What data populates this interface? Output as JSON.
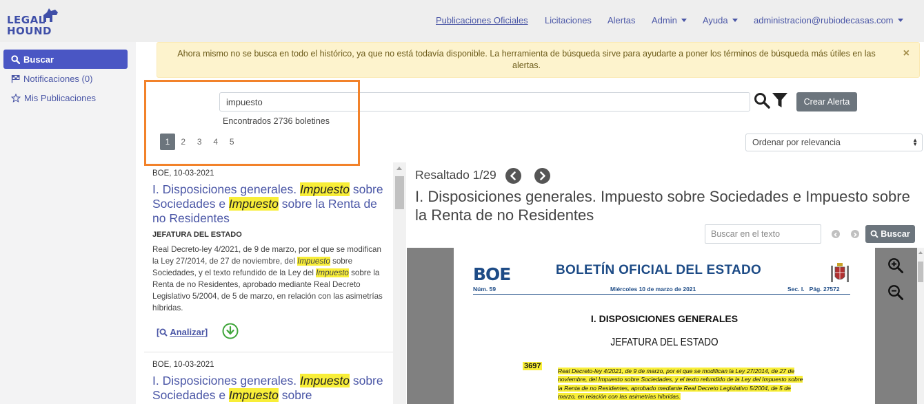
{
  "brand": {
    "line1": "LEGAL",
    "line2": "HOUND",
    "color": "#3f4fa8"
  },
  "nav": {
    "publicaciones": "Publicaciones Oficiales",
    "licitaciones": "Licitaciones",
    "alertas": "Alertas",
    "admin": "Admin",
    "ayuda": "Ayuda",
    "user": "administracion@rubiodecasas.com"
  },
  "sidebar": {
    "items": [
      {
        "label": "Buscar",
        "icon": "search-icon",
        "active": true
      },
      {
        "label": "Notificaciones (0)",
        "icon": "flag-icon"
      },
      {
        "label": "Mis Publicaciones",
        "icon": "star-icon"
      }
    ]
  },
  "alert": {
    "text": "Ahora mismo no se busca en todo el histórico, ya que no está todavía disponible. La herramienta de búsqueda sirve para ayudarte a poner los términos de búsqueda más útiles en las alertas.",
    "close": "×"
  },
  "search": {
    "query": "impuesto",
    "found": "Encontrados 2736 boletines",
    "create_alert": "Crear Alerta",
    "pages": [
      "1",
      "2",
      "3",
      "4",
      "5"
    ],
    "sort": "Ordenar por relevancia"
  },
  "results": [
    {
      "source": "BOE, 10-03-2021",
      "title_parts": [
        "I. Disposiciones generales. ",
        "Impuesto",
        " sobre Sociedades e ",
        "Impuesto",
        " sobre la Renta de no Residentes"
      ],
      "department": "JEFATURA DEL ESTADO",
      "body_parts": [
        "Real Decreto-ley 4/2021, de 9 de marzo, por el que se modifican la Ley 27/2014, de 27 de noviembre, del ",
        "Impuesto",
        " sobre Sociedades, y el texto refundido de la Ley del ",
        "Impuesto",
        " sobre la Renta de no Residentes, aprobado mediante Real Decreto Legislativo 5/2004, de 5 de marzo, en relación con las asimetrías híbridas."
      ],
      "analyze": "Analizar"
    },
    {
      "source": "BOE, 10-03-2021",
      "title_parts": [
        "I. Disposiciones generales. ",
        "Impuesto",
        " sobre Sociedades e ",
        "Impuesto",
        " sobre"
      ]
    }
  ],
  "viewer": {
    "resaltado": "Resaltado 1/29",
    "title": "I. Disposiciones generales. Impuesto sobre Sociedades e Impuesto sobre la Renta de no Residentes",
    "text_search_placeholder": "Buscar en el texto",
    "search_button": "Buscar"
  },
  "pdf": {
    "logo": "BOE",
    "header": "BOLETÍN OFICIAL DEL ESTADO",
    "num": "Núm. 59",
    "date": "Miércoles 10 de marzo de 2021",
    "sec": "Sec. I.   Pág. 27572",
    "section": "I. DISPOSICIONES GENERALES",
    "department": "JEFATURA DEL ESTADO",
    "number": "3697",
    "text": "Real Decreto-ley 4/2021, de 9 de marzo, por el que se modifican la Ley 27/2014, de 27 de noviembre, del Impuesto sobre Sociedades, y el texto refundido de la Ley del Impuesto sobre la Renta de no Residentes, aprobado mediante Real Decreto Legislativo 5/2004, de 5 de marzo, en relación con las asimetrías híbridas."
  },
  "colors": {
    "accent": "#4a56c4",
    "highlight": "#f8ee38",
    "callout": "#f2822a"
  }
}
